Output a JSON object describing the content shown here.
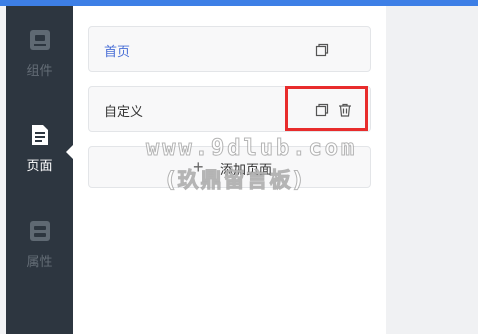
{
  "sidebar": {
    "items": [
      {
        "label": "组件",
        "icon": "component-icon",
        "active": false
      },
      {
        "label": "页面",
        "icon": "page-icon",
        "active": true
      },
      {
        "label": "属性",
        "icon": "property-icon",
        "active": false
      }
    ]
  },
  "pages": {
    "items": [
      {
        "name": "首页",
        "current": true,
        "actions": [
          "copy-icon"
        ]
      },
      {
        "name": "自定义",
        "current": false,
        "actions": [
          "copy-icon",
          "delete-icon"
        ]
      }
    ],
    "add_label": "添加页面"
  },
  "watermark": {
    "url": "www.9dlub.com",
    "text": "(玖鼎留言板)"
  },
  "colors": {
    "sidebar_bg": "#2d3640",
    "accent": "#3d7fe6",
    "link": "#4a6fd6",
    "highlight_box": "#e82c2c"
  }
}
